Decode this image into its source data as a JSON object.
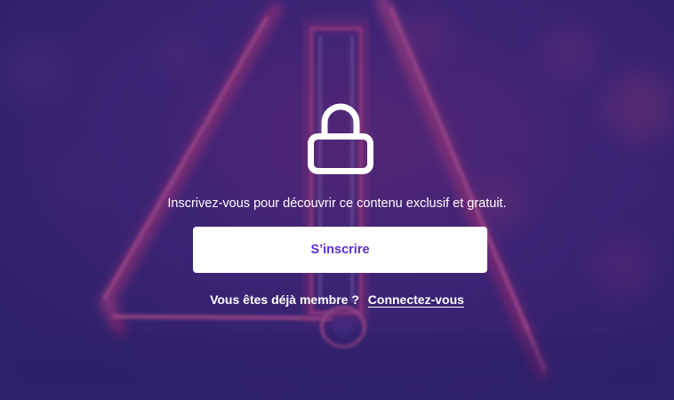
{
  "paywall": {
    "lock_icon": "lock-icon",
    "message": "Inscrivez-vous pour découvrir ce contenu exclusif et gratuit.",
    "signup_label": "S’inscrire",
    "member_prompt": "Vous êtes déjà membre ?",
    "login_label": "Connectez-vous"
  },
  "colors": {
    "background": "#3a2a6e",
    "overlay": "#301e6e",
    "accent_text": "#5c2fd0",
    "neon": "#e0357a",
    "button_bg": "#ffffff"
  }
}
